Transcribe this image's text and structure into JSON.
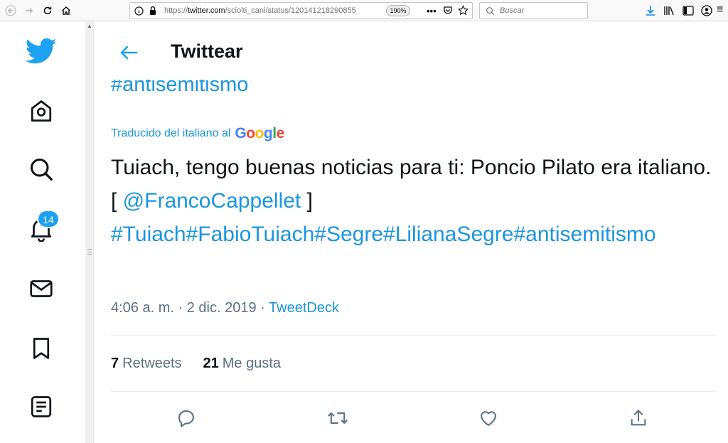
{
  "browser": {
    "url_prefix": "https://",
    "url_host": "twitter.com",
    "url_path": "/sciolti_cani/status/120141218290855",
    "zoom": "190%",
    "search_placeholder": "Buscar"
  },
  "sidebar": {
    "notifications_count": "14"
  },
  "header": {
    "title": "Twittear"
  },
  "tweet": {
    "previous_hashtag": "#antisemitismo",
    "translated_label": "Traducido del italiano al",
    "translator_logo": [
      "G",
      "o",
      "o",
      "g",
      "l",
      "e"
    ],
    "text_before": "Tuiach, tengo buenas noticias para ti: Poncio Pilato era italiano. [ ",
    "mention": "@FrancoCappellet",
    "text_after": " ] ",
    "hashtags": "#Tuiach#FabioTuiach#Segre#LilianaSegre#antisemitismo",
    "time": "4:06 a. m.",
    "separator": "·",
    "date": "2 dic. 2019",
    "source": "TweetDeck"
  },
  "stats": {
    "retweets_count": "7",
    "retweets_label": "Retweets",
    "likes_count": "21",
    "likes_label": "Me gusta"
  },
  "colors": {
    "accent": "#1da1f2",
    "link": "#1b95e0",
    "text": "#0f1419",
    "muted": "#5b7083"
  }
}
